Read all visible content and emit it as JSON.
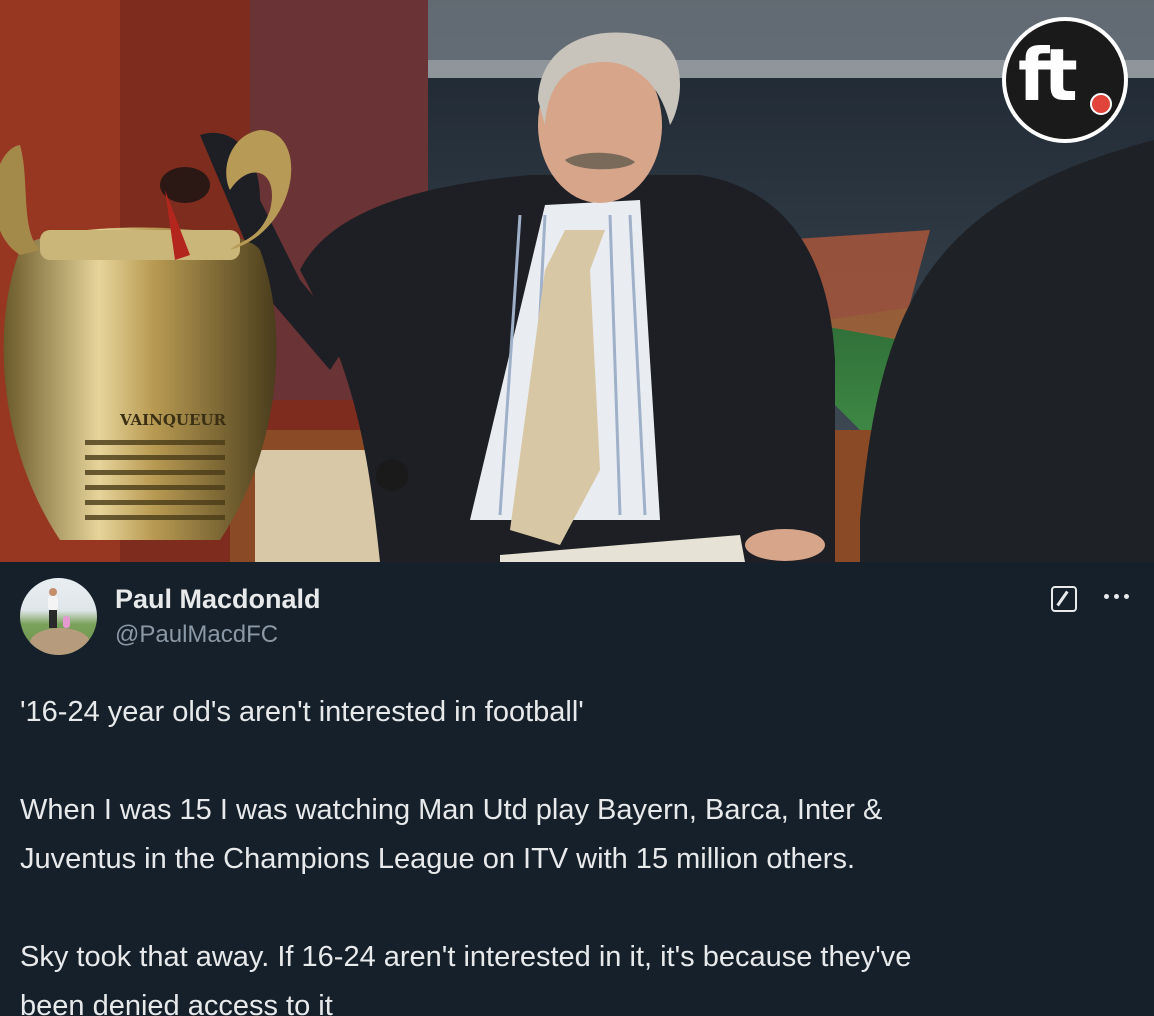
{
  "photo": {
    "alt_icon": "commentator-with-trophy-photo",
    "watermark": "ft",
    "trophy_engraving": "VAINQUEUR"
  },
  "tweet": {
    "author_name": "Paul Macdonald",
    "author_handle": "@PaulMacdFC",
    "paragraphs": {
      "p1": "'16-24 year old's aren't interested in football'",
      "p2_line1": "When I was 15 I was watching Man Utd play Bayern, Barca, Inter &",
      "p2_line2": "Juventus in the Champions League on ITV with 15 million others.",
      "p3_line1": "Sky took that away. If 16-24 aren't interested in it, it's because they've",
      "p3_line2": "been denied access to it"
    },
    "icons": {
      "grok": "grok-icon",
      "more": "more-options-icon"
    }
  },
  "colors": {
    "background": "#15202b",
    "text_primary": "#e7e9ea",
    "text_secondary": "#8b98a5",
    "logo_ball": "#e2443a"
  }
}
